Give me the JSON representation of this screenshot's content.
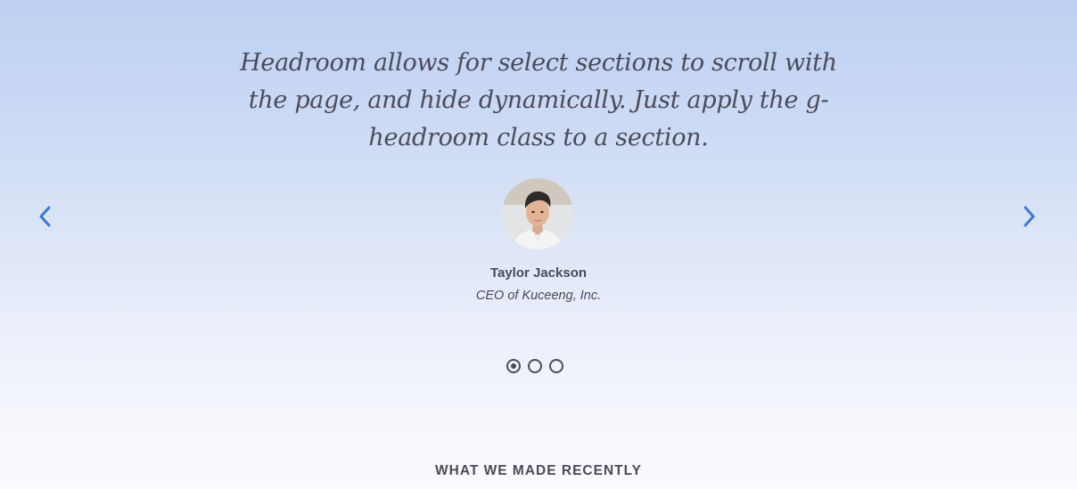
{
  "testimonial": {
    "quote": "Headroom allows for select sections to scroll with the page, and hide dynamically. Just apply the g-headroom class to a section.",
    "name": "Taylor Jackson",
    "title": "CEO of Kuceeng, Inc."
  },
  "carousel": {
    "prev_icon": "chevron-left-icon",
    "next_icon": "chevron-right-icon",
    "slide_count": 3,
    "active_index": 0
  },
  "section": {
    "heading": "WHAT WE MADE RECENTLY"
  },
  "colors": {
    "accent": "#3b7bd0",
    "text": "#4b4b57",
    "background_top": "#bcd0f2",
    "background_bottom": "#fbfbfe"
  }
}
